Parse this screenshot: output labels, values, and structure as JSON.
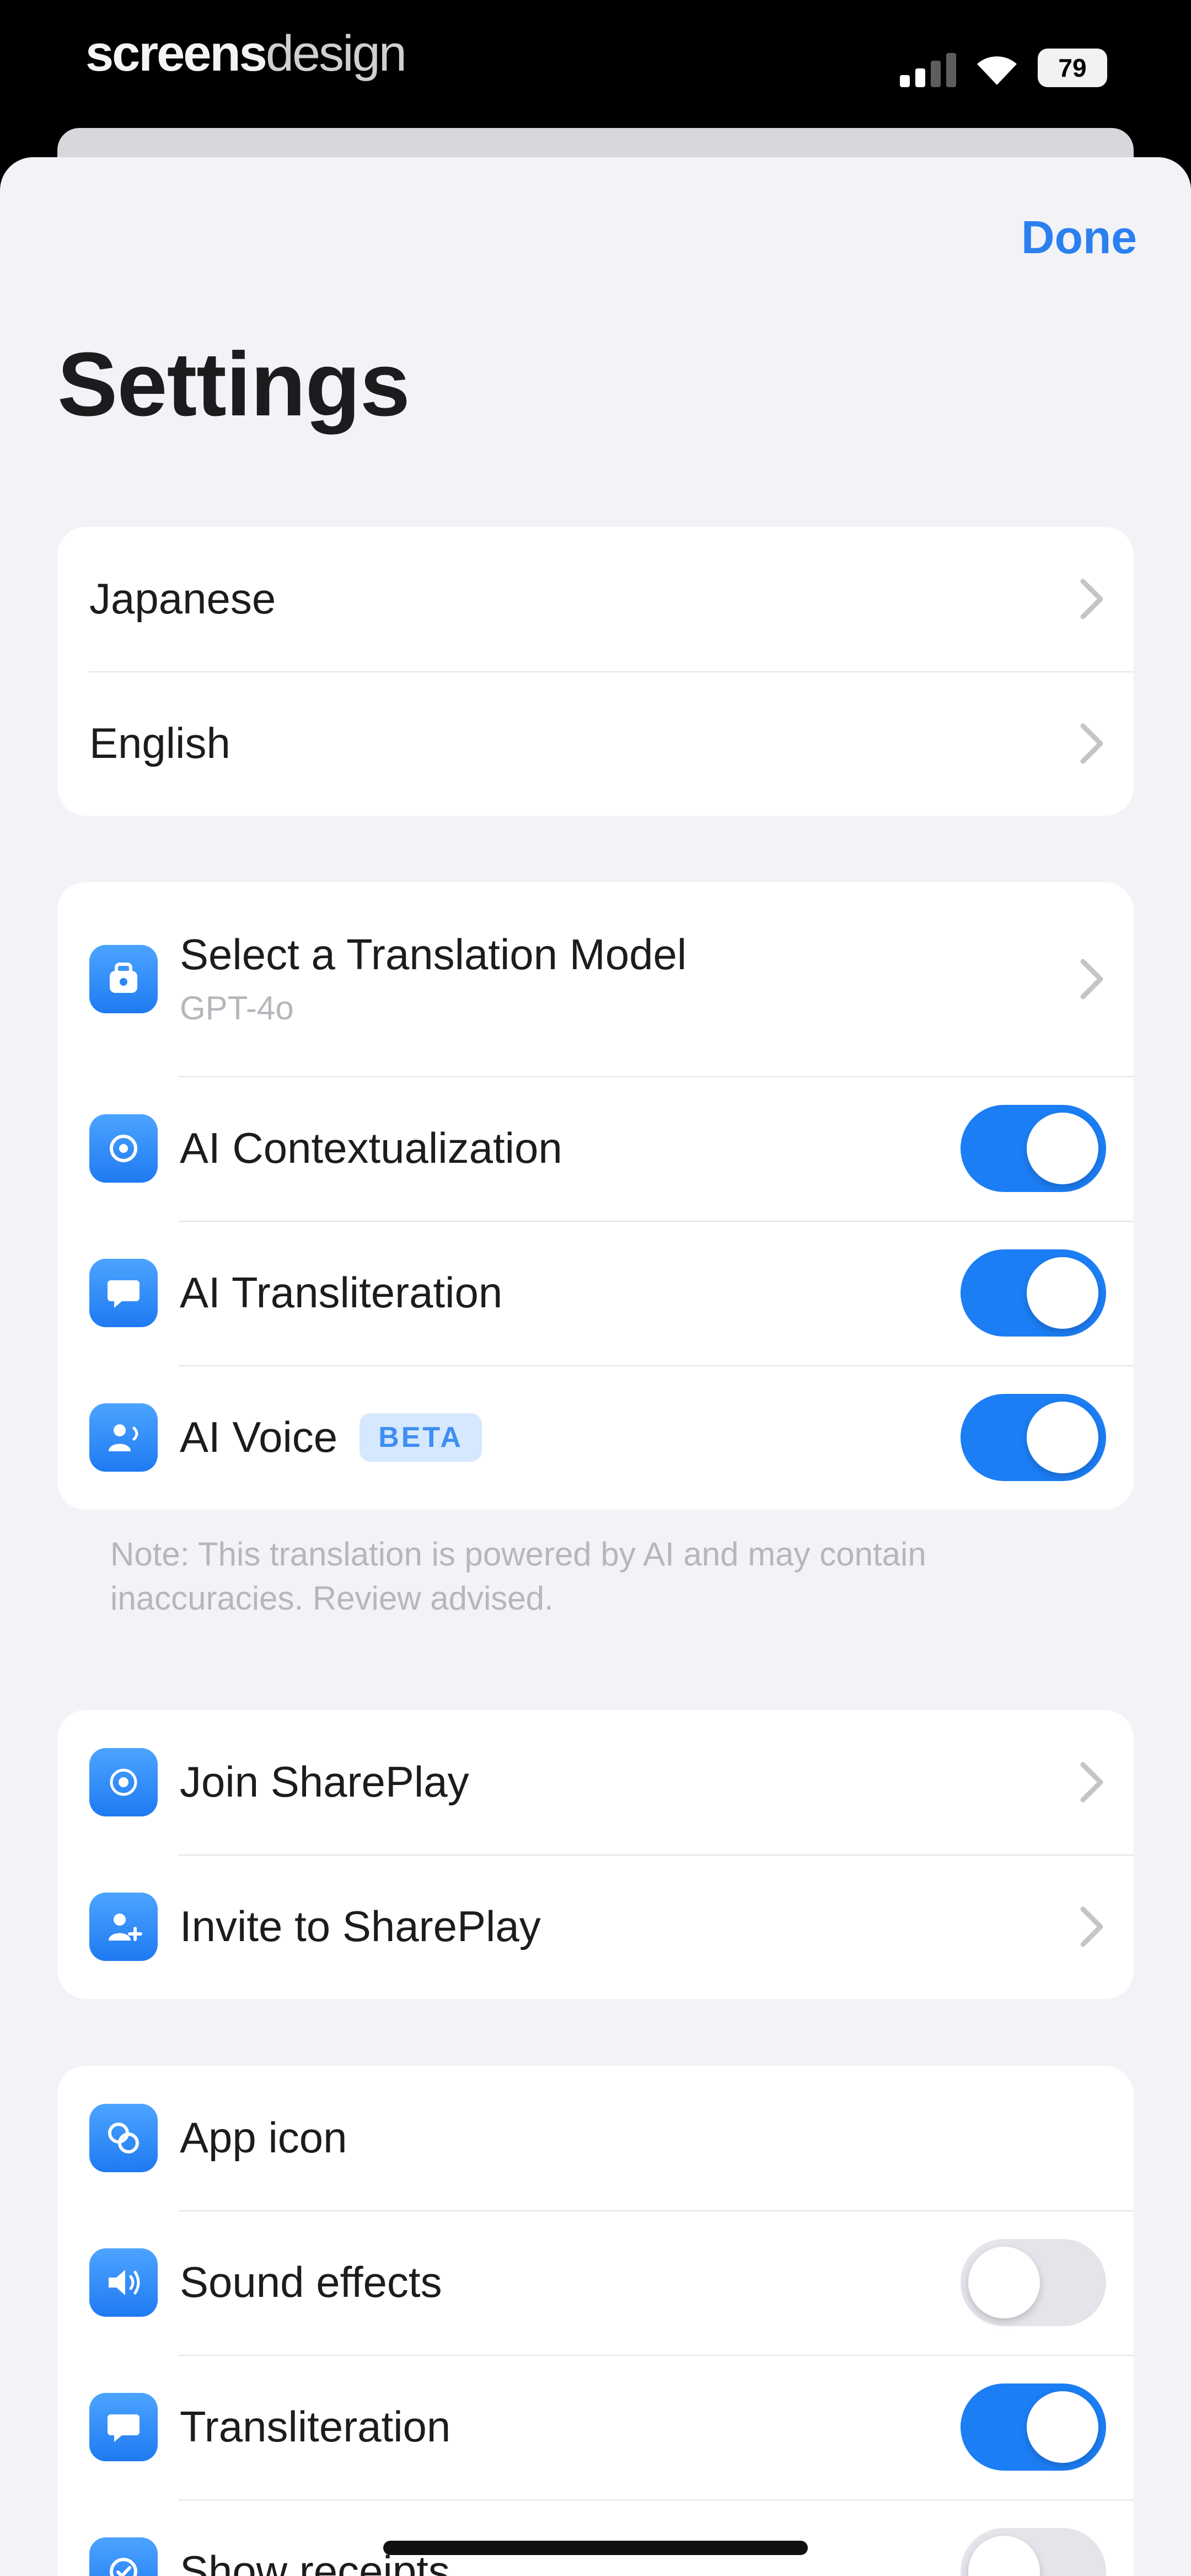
{
  "status_bar": {
    "brand_bold": "screens",
    "brand_light": "design",
    "battery": "79"
  },
  "header": {
    "done_label": "Done",
    "title": "Settings"
  },
  "languages": [
    {
      "label": "Japanese"
    },
    {
      "label": "English"
    }
  ],
  "ai_section": {
    "model_label": "Select a Translation Model",
    "model_value": "GPT-4o",
    "contextualization_label": "AI Contextualization",
    "contextualization_on": true,
    "transliteration_label": "AI Transliteration",
    "transliteration_on": true,
    "voice_label": "AI Voice",
    "voice_badge": "BETA",
    "voice_on": true,
    "note": "Note: This translation is powered by AI and may contain inaccuracies. Review advised."
  },
  "shareplay": {
    "join_label": "Join SharePlay",
    "invite_label": "Invite to SharePlay"
  },
  "preferences": {
    "app_icon_label": "App icon",
    "sound_effects_label": "Sound effects",
    "sound_effects_on": false,
    "transliteration_label": "Transliteration",
    "transliteration_on": true,
    "show_receipts_label": "Show receipts",
    "show_receipts_on": false
  },
  "colors": {
    "accent": "#2b80f0",
    "toggle_on": "#1c7ef5",
    "toggle_off": "#e4e4ea",
    "background": "#f2f2f7"
  }
}
